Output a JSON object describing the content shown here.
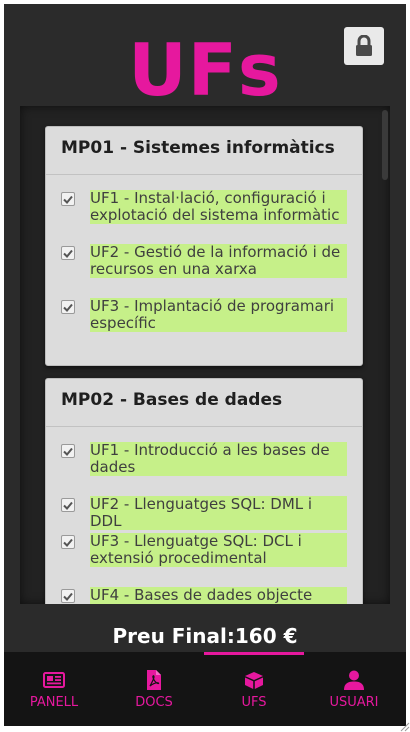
{
  "app": {
    "title": "UFs",
    "lock_icon": "lock-icon"
  },
  "modules": [
    {
      "title": "MP01 - Sistemes informàtics",
      "ufs": [
        {
          "label": "UF1 - Instal·lació, configuració i explotació del sistema informàtic",
          "checked": true
        },
        {
          "label": "UF2 - Gestió de la informació i de recursos en una xarxa",
          "checked": true
        },
        {
          "label": "UF3 - Implantació de programari específic",
          "checked": true
        }
      ]
    },
    {
      "title": "MP02 - Bases de dades",
      "ufs": [
        {
          "label": "UF1 - Introducció a les bases de dades",
          "checked": true
        },
        {
          "label": "UF2 - Llenguatges SQL: DML i DDL",
          "checked": true
        },
        {
          "label": "UF3 - Llenguatge SQL: DCL i extensió procedimental",
          "checked": true
        },
        {
          "label": "UF4 - Bases de dades objecte",
          "checked": true
        }
      ]
    }
  ],
  "footer": {
    "price_label": "Preu Final:160 €"
  },
  "nav": {
    "items": [
      {
        "label": "PANELL",
        "icon": "newspaper-icon"
      },
      {
        "label": "DOCS",
        "icon": "pdf-file-icon"
      },
      {
        "label": "UFS",
        "icon": "box-icon",
        "active": true
      },
      {
        "label": "USUARI",
        "icon": "user-icon"
      }
    ]
  },
  "colors": {
    "accent": "#e6189e",
    "background": "#2b2b2b",
    "card": "#dcdcdc",
    "checked_highlight": "#c6f089",
    "nav_background": "#141414"
  }
}
